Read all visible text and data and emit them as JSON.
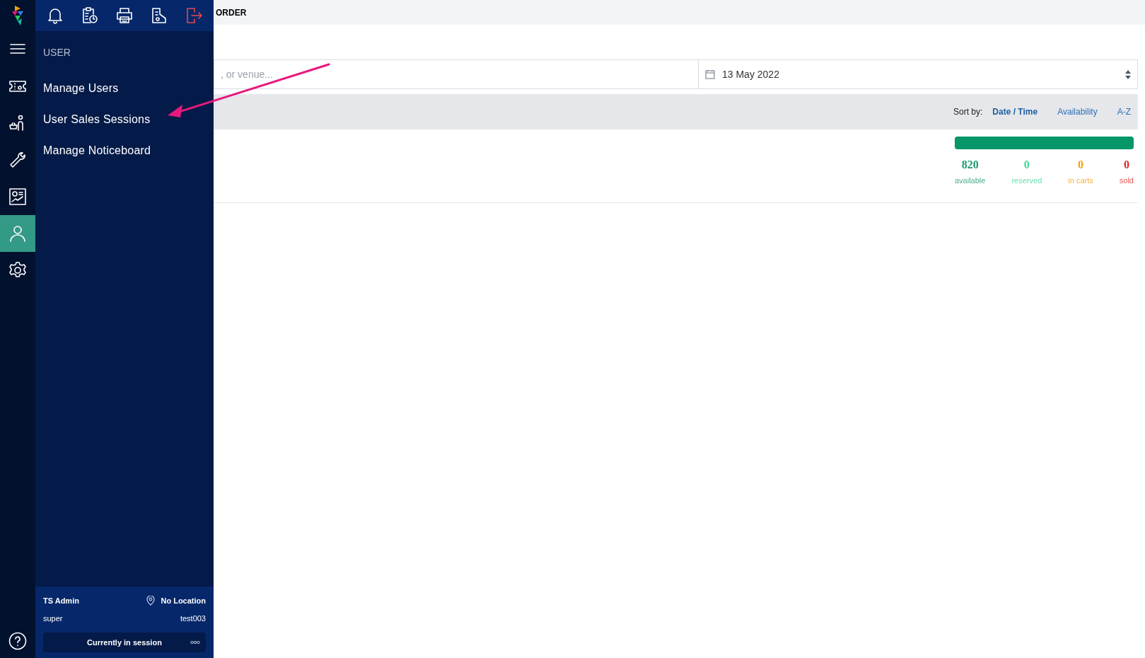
{
  "rail": {
    "items": [
      {
        "kind": "menu",
        "selected": false
      },
      {
        "kind": "ticket",
        "selected": false
      },
      {
        "kind": "customer",
        "selected": false
      },
      {
        "kind": "tools",
        "selected": false
      },
      {
        "kind": "reports",
        "selected": false
      },
      {
        "kind": "user",
        "selected": true
      },
      {
        "kind": "settings",
        "selected": false
      }
    ]
  },
  "toolbar": {
    "items": [
      {
        "kind": "bell"
      },
      {
        "kind": "clipboard-clock"
      },
      {
        "kind": "printer"
      },
      {
        "kind": "receipt"
      },
      {
        "kind": "logout"
      }
    ]
  },
  "drawer": {
    "heading": "USER",
    "items": [
      "Manage Users",
      "User Sales Sessions",
      "Manage Noticeboard"
    ]
  },
  "session": {
    "name": "TS Admin",
    "location": "No Location",
    "role": "super",
    "terminal": "test003",
    "status": "Currently in session"
  },
  "page": {
    "title": "ORDER",
    "search": {
      "placeholder": ", or venue..."
    },
    "date": "13 May 2022",
    "sort": {
      "label": "Sort by:",
      "options": [
        {
          "label": "Date / Time",
          "selected": true
        },
        {
          "label": "Availability",
          "selected": false
        },
        {
          "label": "A-Z",
          "selected": false
        }
      ]
    },
    "event": {
      "level": 1,
      "stats": [
        {
          "value": "820",
          "label": "available",
          "color": "#1a9a6c"
        },
        {
          "value": "0",
          "label": "reserved",
          "color": "#3ddc97"
        },
        {
          "value": "0",
          "label": "in carts",
          "color": "#f59e0b"
        },
        {
          "value": "0",
          "label": "sold",
          "color": "#dc2626"
        }
      ]
    }
  }
}
